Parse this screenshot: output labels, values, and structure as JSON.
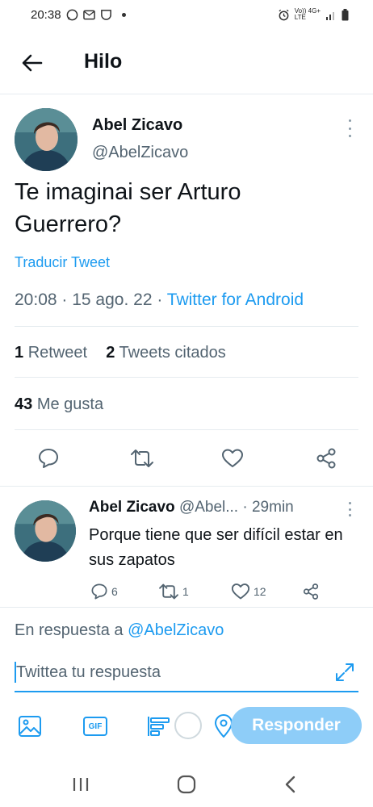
{
  "status_bar": {
    "time": "20:38",
    "network_top": "Vo)) 4G+",
    "network_bottom": "LTE"
  },
  "header": {
    "title": "Hilo"
  },
  "tweet": {
    "author_name": "Abel Zicavo",
    "author_handle": "@AbelZicavo",
    "text": "Te imaginai ser Arturo Guerrero?",
    "translate_label": "Traducir Tweet",
    "time": "20:08",
    "date": "15 ago. 22",
    "client": "Twitter for Android",
    "retweets_count": "1",
    "retweets_label": "Retweet",
    "quotes_count": "2",
    "quotes_label": "Tweets citados",
    "likes_count": "43",
    "likes_label": "Me gusta"
  },
  "reply": {
    "author_name": "Abel Zicavo",
    "author_handle": "@Abel...",
    "time": "29min",
    "text": "Porque tiene que ser difícil estar en sus zapatos",
    "reply_count": "6",
    "retweet_count": "1",
    "like_count": "12"
  },
  "composer": {
    "reply_to_label": "En respuesta a",
    "reply_to_handle": "@AbelZicavo",
    "placeholder": "Twittea tu respuesta",
    "gif_label": "GIF",
    "submit_label": "Responder"
  },
  "colors": {
    "accent": "#1d9bf0",
    "accent_disabled": "#8ecdf8",
    "text": "#0f1419",
    "secondary_text": "#536471",
    "divider": "#e6ecf0"
  }
}
